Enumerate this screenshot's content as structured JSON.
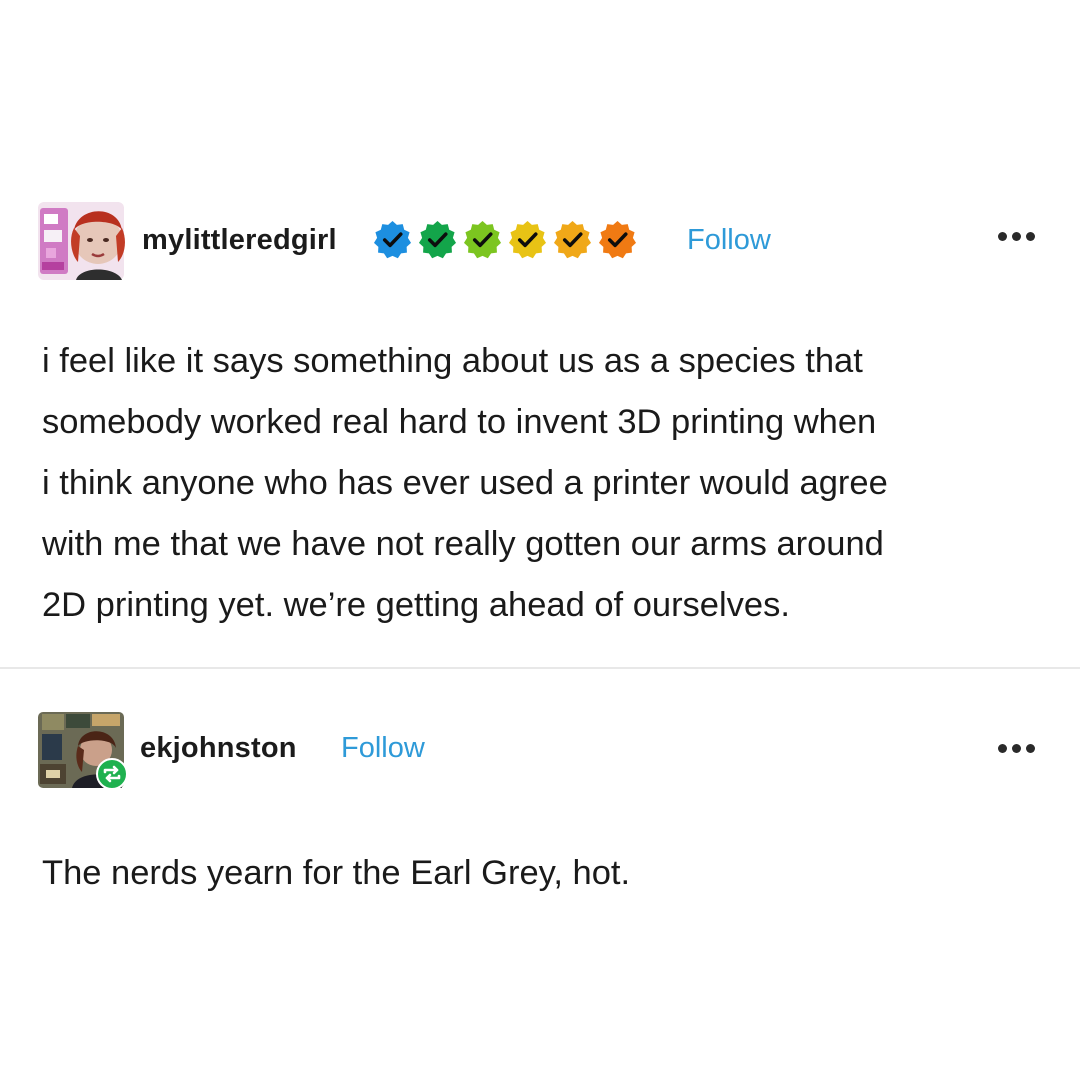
{
  "posts": [
    {
      "username": "mylittleredgirl",
      "follow_label": "Follow",
      "badges": [
        {
          "icon": "verified-badge-icon",
          "color": "#1d8fe0"
        },
        {
          "icon": "verified-badge-icon",
          "color": "#13a54a"
        },
        {
          "icon": "verified-badge-icon",
          "color": "#7cc520"
        },
        {
          "icon": "verified-badge-icon",
          "color": "#e8c315"
        },
        {
          "icon": "verified-badge-icon",
          "color": "#f0a818"
        },
        {
          "icon": "verified-badge-icon",
          "color": "#f07a13"
        }
      ],
      "text": "i feel like it says something about us as a species that\nsomebody worked real hard to invent 3D printing when\ni think anyone who has ever used a printer would agree\nwith me that we have not really gotten our arms around\n2D printing yet. we’re getting ahead of ourselves."
    },
    {
      "username": "ekjohnston",
      "follow_label": "Follow",
      "reblog_icon": "reblog-icon",
      "reblog_color": "#1fb14f",
      "text": "The nerds yearn for the Earl Grey, hot."
    }
  ],
  "colors": {
    "follow": "#2e9ad8",
    "text": "#1a1a1a",
    "divider": "#e8e8e8"
  }
}
